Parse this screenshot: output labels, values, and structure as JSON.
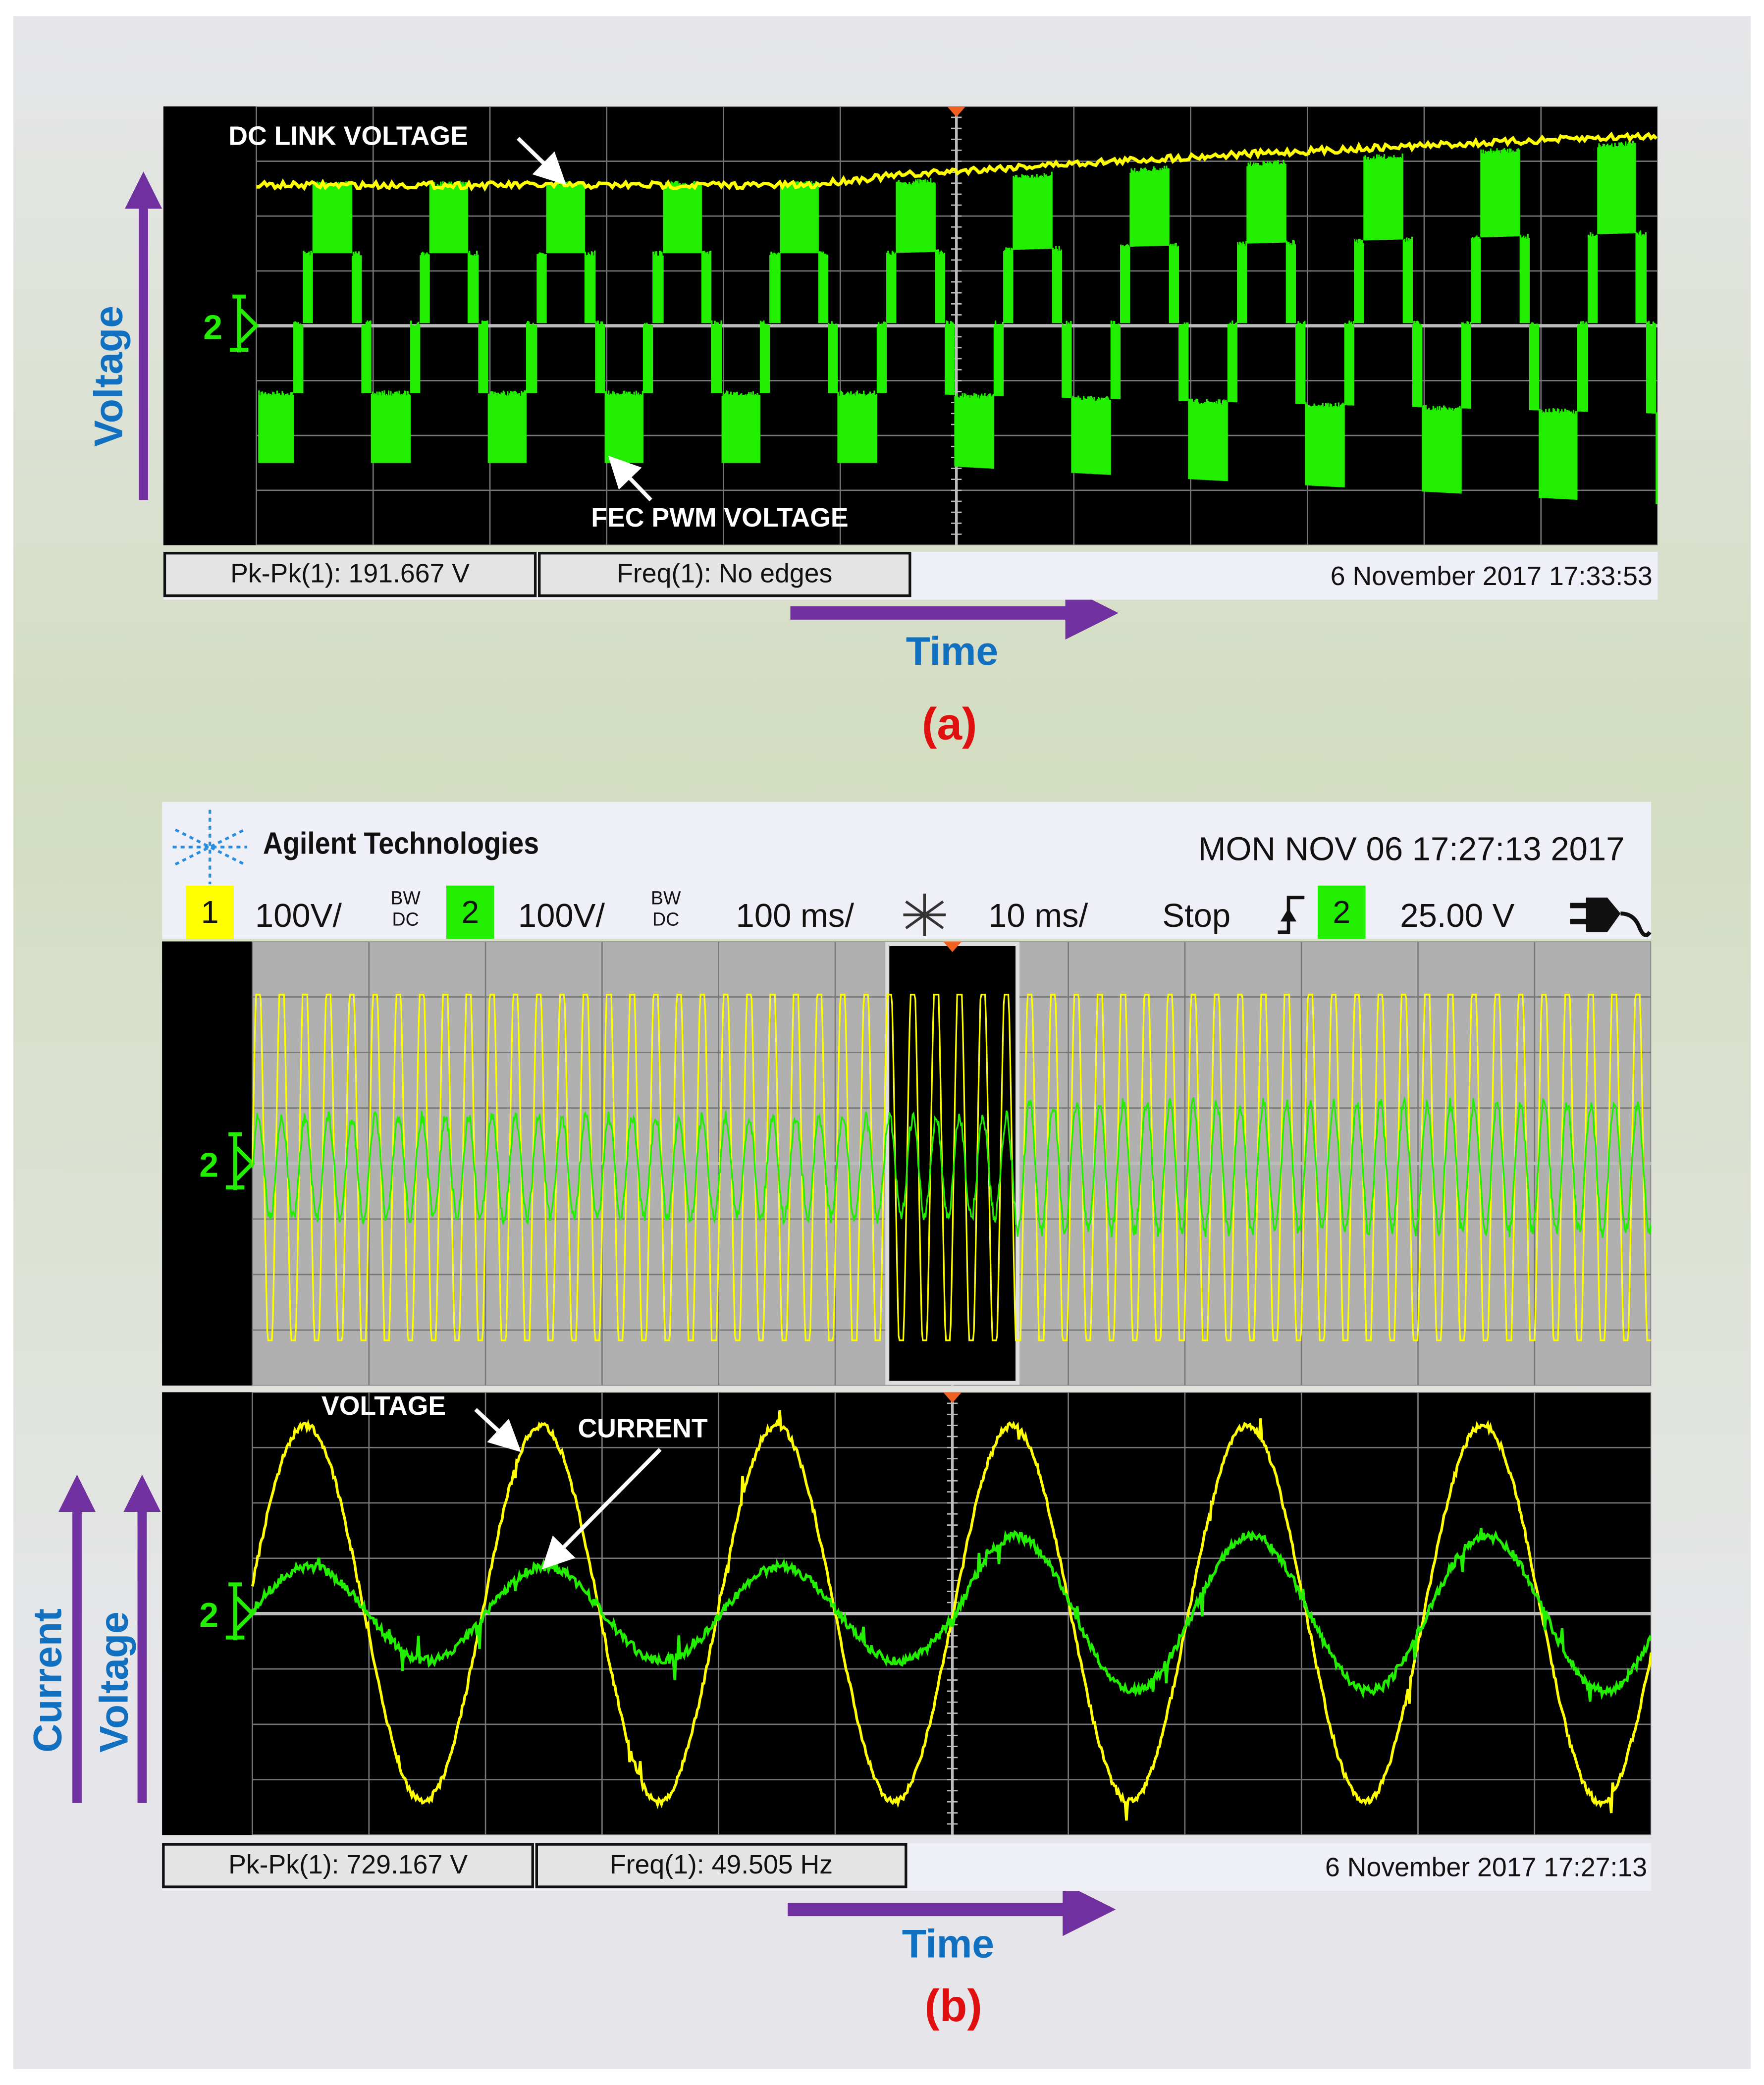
{
  "panel_a": {
    "tag": "(a)",
    "y_axis_label": "Voltage",
    "x_axis_label": "Time",
    "annotations": {
      "dc_link": "DC LINK VOLTAGE",
      "fec_pwm": "FEC PWM VOLTAGE"
    },
    "measurements": [
      "Pk-Pk(1): 191.667 V",
      "Freq(1): No edges"
    ],
    "datestamp": "6 November 2017   17:33:53",
    "trigger_marker": "2"
  },
  "panel_b": {
    "tag": "(b)",
    "y_axis_labels": [
      "Current",
      "Voltage"
    ],
    "x_axis_label": "Time",
    "header": {
      "brand": "Agilent Technologies",
      "datetime": "MON NOV 06  17:27:13  2017",
      "ch1": {
        "number": "1",
        "scale": "100V/",
        "bw": "BW",
        "coupling": "DC",
        "color": "#ffff00"
      },
      "ch2": {
        "number": "2",
        "scale": "100V/",
        "bw": "BW",
        "coupling": "DC",
        "color": "#22ee00"
      },
      "main_timebase": "100 ms/",
      "zoom_timebase": "10 ms/",
      "run_state": "Stop",
      "trigger_source": "2",
      "trigger_level": "25.00 V"
    },
    "annotations": {
      "voltage": "VOLTAGE",
      "current": "CURRENT"
    },
    "measurements": [
      "Pk-Pk(1): 729.167 V",
      "Freq(1): 49.505 Hz"
    ],
    "datestamp": "6 November 2017   17:27:13",
    "trigger_marker": "2"
  },
  "colors": {
    "ch1": "#ffff00",
    "ch2": "#22ee00",
    "axis_arrow": "#7030a0",
    "axis_text": "#1170c0",
    "tag": "#e01010"
  },
  "chart_data": [
    {
      "type": "line",
      "title": "(a) DC link voltage and FEC PWM voltage",
      "xlabel": "Time",
      "ylabel": "Voltage",
      "grid": true,
      "x_divisions": 12,
      "y_divisions": 8,
      "series": [
        {
          "name": "DC LINK VOLTAGE",
          "color": "#ffff00",
          "level_div_start": 2.5,
          "level_div_end": 3.4
        },
        {
          "name": "FEC PWM VOLTAGE",
          "color": "#22ee00",
          "cycle_div": 1.0,
          "levels": 5,
          "amplitude_div_start": 2.55,
          "amplitude_div_end": 3.3
        }
      ]
    },
    {
      "type": "line",
      "title": "(b) Grid voltage and current",
      "xlabel": "Time",
      "ylabel": "Voltage / Current",
      "grid": true,
      "x_divisions": 12,
      "y_divisions": 8,
      "time_per_div_ms": 10,
      "frequency_hz": 49.505,
      "series": [
        {
          "name": "VOLTAGE",
          "color": "#ffff00",
          "amplitude_V": 340
        },
        {
          "name": "CURRENT",
          "color": "#22ee00",
          "amplitude_div_start": 0.85,
          "amplitude_div_end": 1.4
        }
      ]
    }
  ]
}
